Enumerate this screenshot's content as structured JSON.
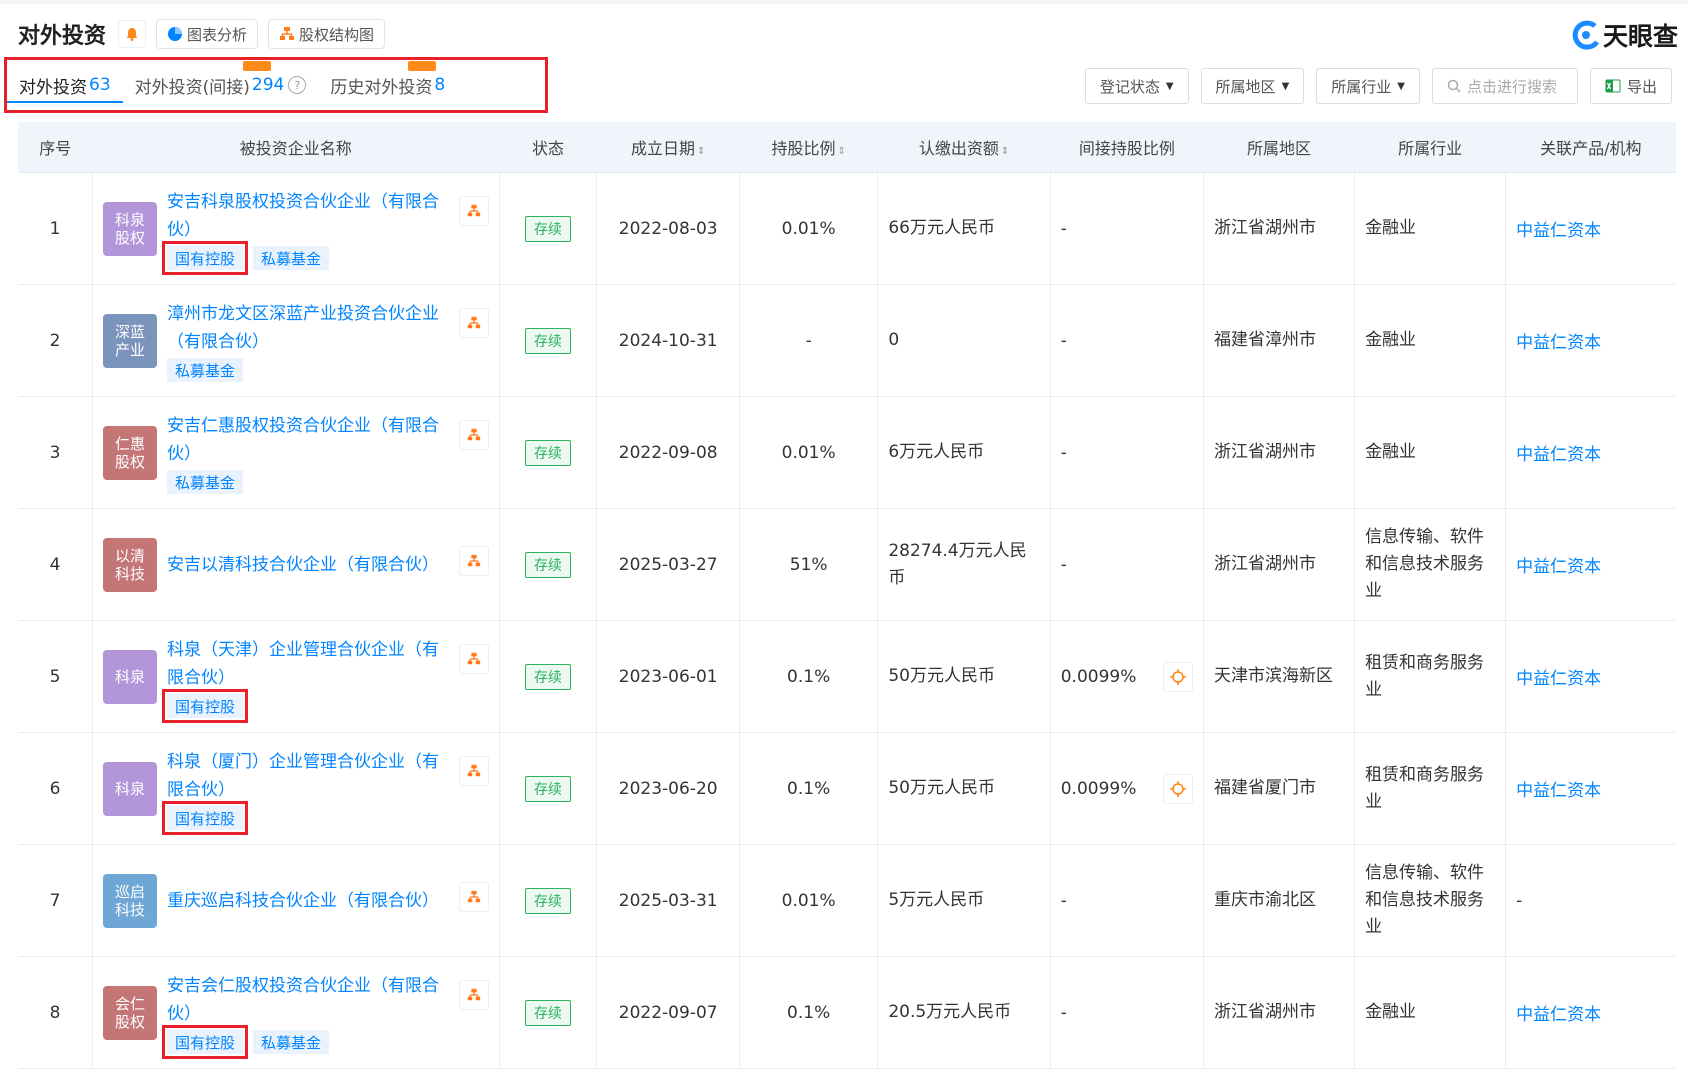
{
  "header": {
    "title": "对外投资",
    "chart_btn": "图表分析",
    "equity_btn": "股权结构图",
    "brand": "天眼查"
  },
  "tabs": [
    {
      "label": "对外投资",
      "count": "63"
    },
    {
      "label": "对外投资(间接)",
      "count": "294"
    },
    {
      "label": "历史对外投资",
      "count": "8"
    }
  ],
  "filters": {
    "reg_status": "登记状态",
    "region": "所属地区",
    "industry": "所属行业",
    "search_placeholder": "点击进行搜索",
    "export": "导出"
  },
  "columns": {
    "idx": "序号",
    "name": "被投资企业名称",
    "status": "状态",
    "date": "成立日期",
    "ratio": "持股比例",
    "capital": "认缴出资额",
    "indirect": "间接持股比例",
    "region": "所属地区",
    "industry": "所属行业",
    "related": "关联产品/机构"
  },
  "rows": [
    {
      "idx": "1",
      "avatar": "科泉\n股权",
      "avatar_color": "#b395d9",
      "name": "安吉科泉股权投资合伙企业（有限合伙）",
      "tag1": "国有控股",
      "tag2": "私募基金",
      "status": "存续",
      "date": "2022-08-03",
      "ratio": "0.01%",
      "capital": "66万元人民币",
      "indirect": "-",
      "region": "浙江省湖州市",
      "industry": "金融业",
      "related": "中益仁资本"
    },
    {
      "idx": "2",
      "avatar": "深蓝\n产业",
      "avatar_color": "#7a94bb",
      "name": "漳州市龙文区深蓝产业投资合伙企业（有限合伙）",
      "tag1": "私募基金",
      "tag2": "",
      "status": "存续",
      "date": "2024-10-31",
      "ratio": "-",
      "capital": "0",
      "indirect": "-",
      "region": "福建省漳州市",
      "industry": "金融业",
      "related": "中益仁资本"
    },
    {
      "idx": "3",
      "avatar": "仁惠\n股权",
      "avatar_color": "#c47575",
      "name": "安吉仁惠股权投资合伙企业（有限合伙）",
      "tag1": "私募基金",
      "tag2": "",
      "status": "存续",
      "date": "2022-09-08",
      "ratio": "0.01%",
      "capital": "6万元人民币",
      "indirect": "-",
      "region": "浙江省湖州市",
      "industry": "金融业",
      "related": "中益仁资本"
    },
    {
      "idx": "4",
      "avatar": "以清\n科技",
      "avatar_color": "#c47575",
      "name": "安吉以清科技合伙企业（有限合伙）",
      "tag1": "",
      "tag2": "",
      "status": "存续",
      "date": "2025-03-27",
      "ratio": "51%",
      "capital": "28274.4万元人民币",
      "indirect": "-",
      "region": "浙江省湖州市",
      "industry": "信息传输、软件和信息技术服务业",
      "related": "中益仁资本"
    },
    {
      "idx": "5",
      "avatar": "科泉",
      "avatar_color": "#b395d9",
      "name": "科泉（天津）企业管理合伙企业（有限合伙）",
      "tag1": "国有控股",
      "tag2": "",
      "status": "存续",
      "date": "2023-06-01",
      "ratio": "0.1%",
      "capital": "50万元人民币",
      "indirect": "0.0099%",
      "region": "天津市滨海新区",
      "industry": "租赁和商务服务业",
      "related": "中益仁资本"
    },
    {
      "idx": "6",
      "avatar": "科泉",
      "avatar_color": "#b395d9",
      "name": "科泉（厦门）企业管理合伙企业（有限合伙）",
      "tag1": "国有控股",
      "tag2": "",
      "status": "存续",
      "date": "2023-06-20",
      "ratio": "0.1%",
      "capital": "50万元人民币",
      "indirect": "0.0099%",
      "region": "福建省厦门市",
      "industry": "租赁和商务服务业",
      "related": "中益仁资本"
    },
    {
      "idx": "7",
      "avatar": "巡启\n科技",
      "avatar_color": "#6ea6d6",
      "name": "重庆巡启科技合伙企业（有限合伙）",
      "tag1": "",
      "tag2": "",
      "status": "存续",
      "date": "2025-03-31",
      "ratio": "0.01%",
      "capital": "5万元人民币",
      "indirect": "-",
      "region": "重庆市渝北区",
      "industry": "信息传输、软件和信息技术服务业",
      "related": "-"
    },
    {
      "idx": "8",
      "avatar": "会仁\n股权",
      "avatar_color": "#c47575",
      "name": "安吉会仁股权投资合伙企业（有限合伙）",
      "tag1": "国有控股",
      "tag2": "私募基金",
      "status": "存续",
      "date": "2022-09-07",
      "ratio": "0.1%",
      "capital": "20.5万元人民币",
      "indirect": "-",
      "region": "浙江省湖州市",
      "industry": "金融业",
      "related": "中益仁资本"
    }
  ],
  "colors": {
    "accent": "#0084ff",
    "highlight": "#e8202a",
    "status_green": "#2bb35b"
  }
}
